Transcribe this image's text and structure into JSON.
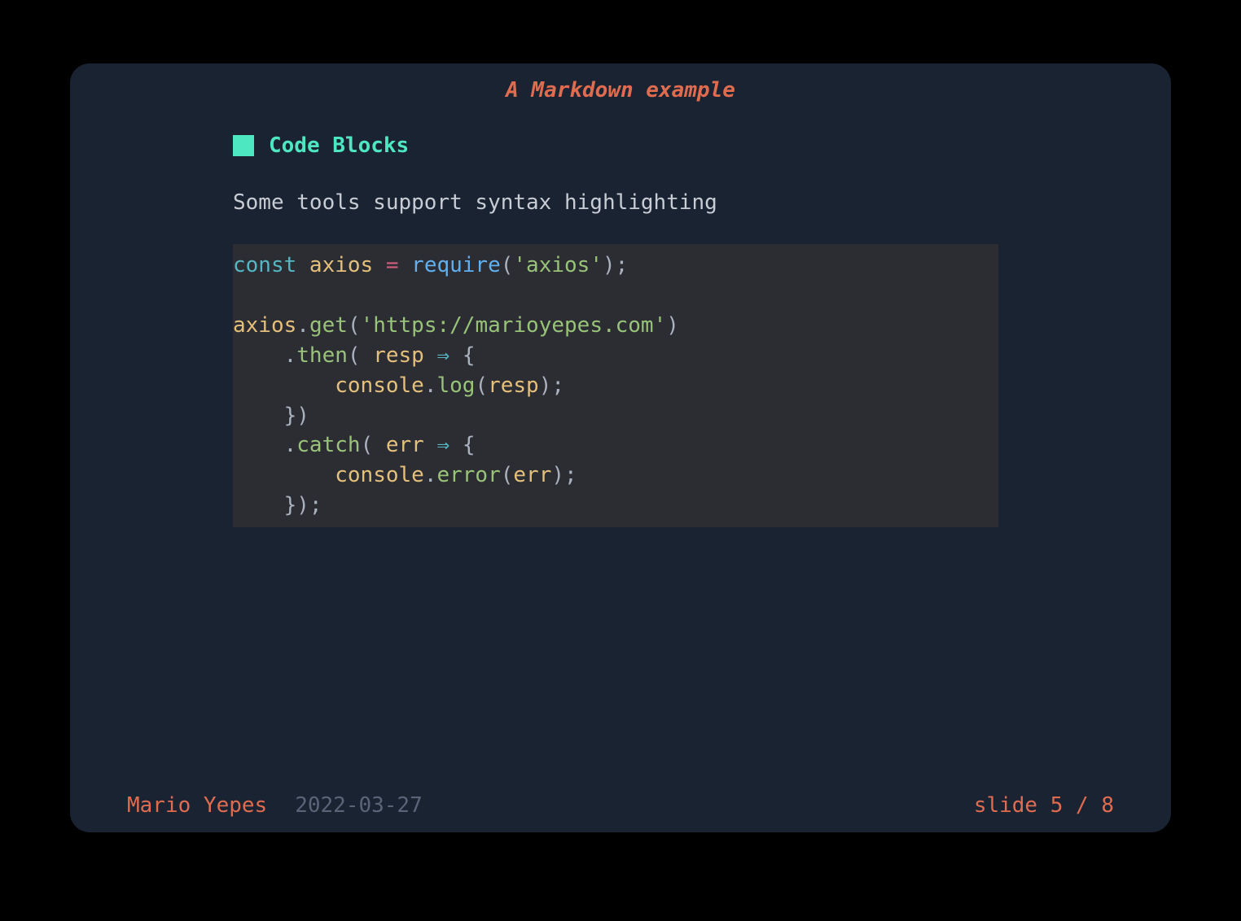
{
  "title": "A Markdown example",
  "section": {
    "heading": "Code Blocks",
    "text": "Some tools support syntax highlighting"
  },
  "code": {
    "line1_kw": "const",
    "line1_var": " axios ",
    "line1_op": "=",
    "line1_fn": " require",
    "line1_paren_open": "(",
    "line1_str": "'axios'",
    "line1_paren_close": ");",
    "line3_obj": "axios",
    "line3_dot": ".",
    "line3_method": "get",
    "line3_paren_open": "(",
    "line3_str": "'https://marioyepes.com'",
    "line3_paren_close": ")",
    "line4_indent": "    ",
    "line4_dot": ".",
    "line4_method": "then",
    "line4_paren_open": "( ",
    "line4_param": "resp",
    "line4_arrow": " ⇒ ",
    "line4_brace": "{",
    "line5_indent": "        ",
    "line5_obj": "console",
    "line5_dot": ".",
    "line5_method": "log",
    "line5_paren_open": "(",
    "line5_param": "resp",
    "line5_paren_close": ");",
    "line6_indent": "    ",
    "line6_brace": "})",
    "line7_indent": "    ",
    "line7_dot": ".",
    "line7_method": "catch",
    "line7_paren_open": "( ",
    "line7_param": "err",
    "line7_arrow": " ⇒ ",
    "line7_brace": "{",
    "line8_indent": "        ",
    "line8_obj": "console",
    "line8_dot": ".",
    "line8_method": "error",
    "line8_paren_open": "(",
    "line8_param": "err",
    "line8_paren_close": ");",
    "line9_indent": "    ",
    "line9_brace": "});"
  },
  "footer": {
    "author": "Mario Yepes",
    "date": "2022-03-27",
    "slide_counter": "slide 5 / 8"
  }
}
